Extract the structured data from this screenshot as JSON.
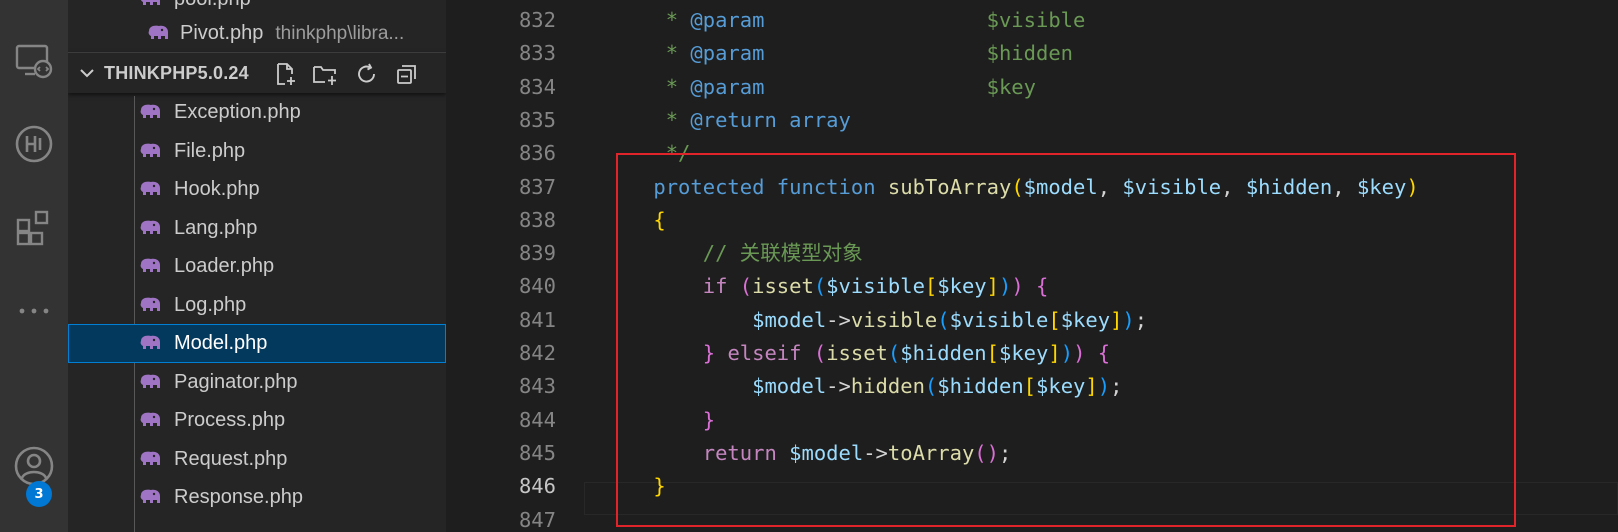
{
  "activity_bar": {
    "items": [
      {
        "icon": "remote-explorer-icon"
      },
      {
        "icon": "gitlens-icon"
      },
      {
        "icon": "extensions-icon"
      },
      {
        "icon": "more-icon",
        "label": "..."
      },
      {
        "icon": "accounts-icon"
      }
    ],
    "accounts_badge": "3"
  },
  "sidebar": {
    "top_files": [
      {
        "name": "pool.php",
        "desc": ""
      },
      {
        "name": "Pivot.php",
        "desc": "thinkphp\\libra..."
      }
    ],
    "section_title": "THINKPHP5.0.24",
    "section_actions": [
      "new-file-icon",
      "new-folder-icon",
      "refresh-icon",
      "collapse-all-icon"
    ],
    "files": [
      {
        "name": "Exception.php"
      },
      {
        "name": "File.php"
      },
      {
        "name": "Hook.php"
      },
      {
        "name": "Lang.php"
      },
      {
        "name": "Loader.php"
      },
      {
        "name": "Log.php"
      },
      {
        "name": "Model.php",
        "selected": true
      },
      {
        "name": "Paginator.php"
      },
      {
        "name": "Process.php"
      },
      {
        "name": "Request.php"
      },
      {
        "name": "Response.php"
      }
    ]
  },
  "editor": {
    "lines": [
      {
        "num": "832",
        "tokens": [
          [
            "c-cm",
            "     * "
          ],
          [
            "c-doc",
            "@param"
          ],
          [
            "c-cm",
            "                  $visible"
          ]
        ]
      },
      {
        "num": "833",
        "tokens": [
          [
            "c-cm",
            "     * "
          ],
          [
            "c-doc",
            "@param"
          ],
          [
            "c-cm",
            "                  $hidden"
          ]
        ]
      },
      {
        "num": "834",
        "tokens": [
          [
            "c-cm",
            "     * "
          ],
          [
            "c-doc",
            "@param"
          ],
          [
            "c-cm",
            "                  $key"
          ]
        ]
      },
      {
        "num": "835",
        "tokens": [
          [
            "c-cm",
            "     * "
          ],
          [
            "c-doc",
            "@return"
          ],
          [
            "c-cm",
            " "
          ],
          [
            "c-doc",
            "array"
          ]
        ]
      },
      {
        "num": "836",
        "tokens": [
          [
            "c-cm",
            "     */"
          ]
        ]
      },
      {
        "num": "837",
        "tokens": [
          [
            "c-kw",
            "    protected"
          ],
          [
            "c-txt",
            " "
          ],
          [
            "c-kw",
            "function"
          ],
          [
            "c-txt",
            " "
          ],
          [
            "c-fn",
            "subToArray"
          ],
          [
            "c-br",
            "("
          ],
          [
            "c-var",
            "$model"
          ],
          [
            "c-txt",
            ", "
          ],
          [
            "c-var",
            "$visible"
          ],
          [
            "c-txt",
            ", "
          ],
          [
            "c-var",
            "$hidden"
          ],
          [
            "c-txt",
            ", "
          ],
          [
            "c-var",
            "$key"
          ],
          [
            "c-br",
            ")"
          ]
        ]
      },
      {
        "num": "838",
        "tokens": [
          [
            "c-br",
            "    {"
          ]
        ]
      },
      {
        "num": "839",
        "tokens": [
          [
            "c-cm",
            "        // 关联模型对象"
          ]
        ]
      },
      {
        "num": "840",
        "tokens": [
          [
            "c-ctl",
            "        if"
          ],
          [
            "c-txt",
            " "
          ],
          [
            "c-br2",
            "("
          ],
          [
            "c-fn",
            "isset"
          ],
          [
            "c-br3",
            "("
          ],
          [
            "c-var",
            "$visible"
          ],
          [
            "c-br",
            "["
          ],
          [
            "c-var",
            "$key"
          ],
          [
            "c-br",
            "]"
          ],
          [
            "c-br3",
            ")"
          ],
          [
            "c-br2",
            ")"
          ],
          [
            "c-txt",
            " "
          ],
          [
            "c-br2",
            "{"
          ]
        ]
      },
      {
        "num": "841",
        "tokens": [
          [
            "c-var",
            "            $model"
          ],
          [
            "c-txt",
            "->"
          ],
          [
            "c-fn",
            "visible"
          ],
          [
            "c-br3",
            "("
          ],
          [
            "c-var",
            "$visible"
          ],
          [
            "c-br",
            "["
          ],
          [
            "c-var",
            "$key"
          ],
          [
            "c-br",
            "]"
          ],
          [
            "c-br3",
            ")"
          ],
          [
            "c-txt",
            ";"
          ]
        ]
      },
      {
        "num": "842",
        "tokens": [
          [
            "c-br2",
            "        }"
          ],
          [
            "c-txt",
            " "
          ],
          [
            "c-ctl",
            "elseif"
          ],
          [
            "c-txt",
            " "
          ],
          [
            "c-br2",
            "("
          ],
          [
            "c-fn",
            "isset"
          ],
          [
            "c-br3",
            "("
          ],
          [
            "c-var",
            "$hidden"
          ],
          [
            "c-br",
            "["
          ],
          [
            "c-var",
            "$key"
          ],
          [
            "c-br",
            "]"
          ],
          [
            "c-br3",
            ")"
          ],
          [
            "c-br2",
            ")"
          ],
          [
            "c-txt",
            " "
          ],
          [
            "c-br2",
            "{"
          ]
        ]
      },
      {
        "num": "843",
        "tokens": [
          [
            "c-var",
            "            $model"
          ],
          [
            "c-txt",
            "->"
          ],
          [
            "c-fn",
            "hidden"
          ],
          [
            "c-br3",
            "("
          ],
          [
            "c-var",
            "$hidden"
          ],
          [
            "c-br",
            "["
          ],
          [
            "c-var",
            "$key"
          ],
          [
            "c-br",
            "]"
          ],
          [
            "c-br3",
            ")"
          ],
          [
            "c-txt",
            ";"
          ]
        ]
      },
      {
        "num": "844",
        "tokens": [
          [
            "c-br2",
            "        }"
          ]
        ]
      },
      {
        "num": "845",
        "tokens": [
          [
            "c-ctl",
            "        return"
          ],
          [
            "c-txt",
            " "
          ],
          [
            "c-var",
            "$model"
          ],
          [
            "c-txt",
            "->"
          ],
          [
            "c-fn",
            "toArray"
          ],
          [
            "c-br2",
            "()"
          ],
          [
            "c-txt",
            ";"
          ]
        ]
      },
      {
        "num": "846",
        "tokens": [
          [
            "c-br",
            "    }"
          ]
        ],
        "active": true
      },
      {
        "num": "847",
        "tokens": []
      }
    ]
  },
  "colors": {
    "activity_bg": "#333333",
    "sidebar_bg": "#252526",
    "editor_bg": "#1e1e1e",
    "selection_bg": "#04395e",
    "highlight_box": "#e0242a",
    "badge": "#0078d4"
  }
}
